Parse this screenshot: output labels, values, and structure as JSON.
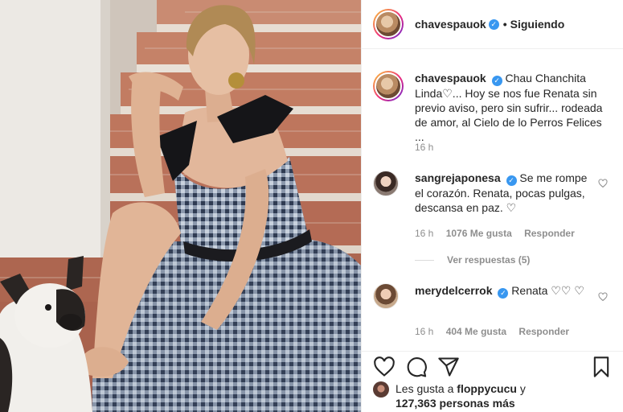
{
  "post": {
    "username": "chavespauok",
    "follow_status": "Siguiendo",
    "dot": "•",
    "caption": "Chau Chanchita Linda♡... Hoy se nos fue Renata sin previo aviso, pero sin sufrir... rodeada de amor, al Cielo de lo Perros Felices ...",
    "caption_time": "16 h"
  },
  "comments": [
    {
      "username": "sangrejaponesa",
      "text": "Se me rompe el corazón. Renata, pocas pulgas, descansa en paz. ♡",
      "time": "16 h",
      "likes": "1076 Me gusta",
      "reply_label": "Responder",
      "view_replies": "Ver respuestas (5)"
    },
    {
      "username": "merydelcerrok",
      "text": "Renata ♡♡ ♡",
      "time": "16 h",
      "likes": "404 Me gusta",
      "reply_label": "Responder"
    }
  ],
  "likes_summary": {
    "prefix": "Les gusta a",
    "user": "floppycucu",
    "suffix": "y",
    "others": "127,363 personas más"
  },
  "icons": [
    "verified-badge-icon",
    "heart-icon",
    "comment-icon",
    "share-icon",
    "bookmark-icon"
  ],
  "colors": {
    "accent": "#3897f0",
    "muted": "#8e8e8e",
    "text": "#262626"
  }
}
